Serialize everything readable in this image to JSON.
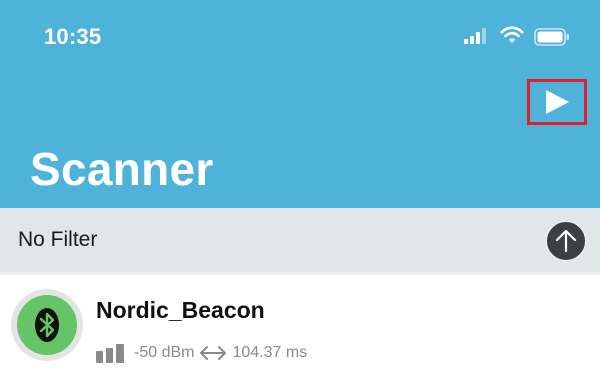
{
  "status_bar": {
    "time": "10:35"
  },
  "header": {
    "title": "Scanner",
    "scan_toggle_icon": "play-icon"
  },
  "filter": {
    "label": "No Filter",
    "sort_icon": "arrow-up-icon"
  },
  "devices": [
    {
      "name": "Nordic_Beacon",
      "rssi": "-50 dBm",
      "interval": "104.37 ms",
      "icon": "bluetooth-icon",
      "avatar_color": "#65c466"
    }
  ],
  "colors": {
    "header_bg": "#4fb3d9",
    "filter_bg": "#e1e6e7",
    "highlight": "#e0202a"
  }
}
